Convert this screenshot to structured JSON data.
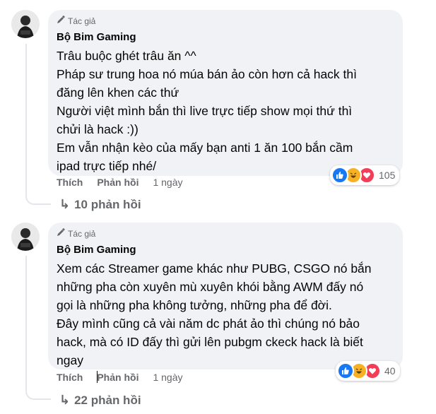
{
  "comments": [
    {
      "badge_label": "Tác giả",
      "badge_icon": "pencil-icon",
      "author": "Bộ Bim Gaming",
      "lines": [
        "Trâu buộc ghét trâu ăn ^^",
        "Pháp sư trung hoa nó múa bán ảo còn hơn cả hack thì",
        "đăng lên khen các thứ",
        "Người việt mình bắn thì live trực tiếp show mọi thứ thì",
        "chửi là hack :))",
        "Em vẫn nhận kèo của mấy bạn anti 1 ăn 100 bắn cầm",
        "ipad trực tiếp nhé/"
      ],
      "reactions": [
        "like",
        "haha",
        "love"
      ],
      "reaction_count": "105",
      "like_label": "Thích",
      "reply_label": "Phản hồi",
      "time": "1 ngày",
      "replies_label": "10 phản hồi"
    },
    {
      "badge_label": "Tác giả",
      "badge_icon": "pencil-icon",
      "author": "Bộ Bim Gaming",
      "lines": [
        "Xem các Streamer game khác như PUBG, CSGO nó bắn",
        "những pha còn xuyên mù xuyên khói bằng AWM đấy nó",
        "gọi là những pha không tưởng, những pha để đời.",
        "Đây mình cũng cả vài năm dc phát ảo thì chúng nó bảo",
        "hack, mà có ID đấy thì gửi lên pubgm ckeck hack là biết",
        "ngay"
      ],
      "reactions": [
        "like",
        "haha",
        "love"
      ],
      "reaction_count": "40",
      "like_label": "Thích",
      "reply_label": "Phản hồi",
      "time": "1 ngày",
      "replies_label": "22 phản hồi"
    }
  ],
  "colors": {
    "like": "#1877f2",
    "love": "#f33e58",
    "haha": "#f7b125",
    "bubble": "#f0f2f5",
    "secondary_text": "#65676b"
  }
}
